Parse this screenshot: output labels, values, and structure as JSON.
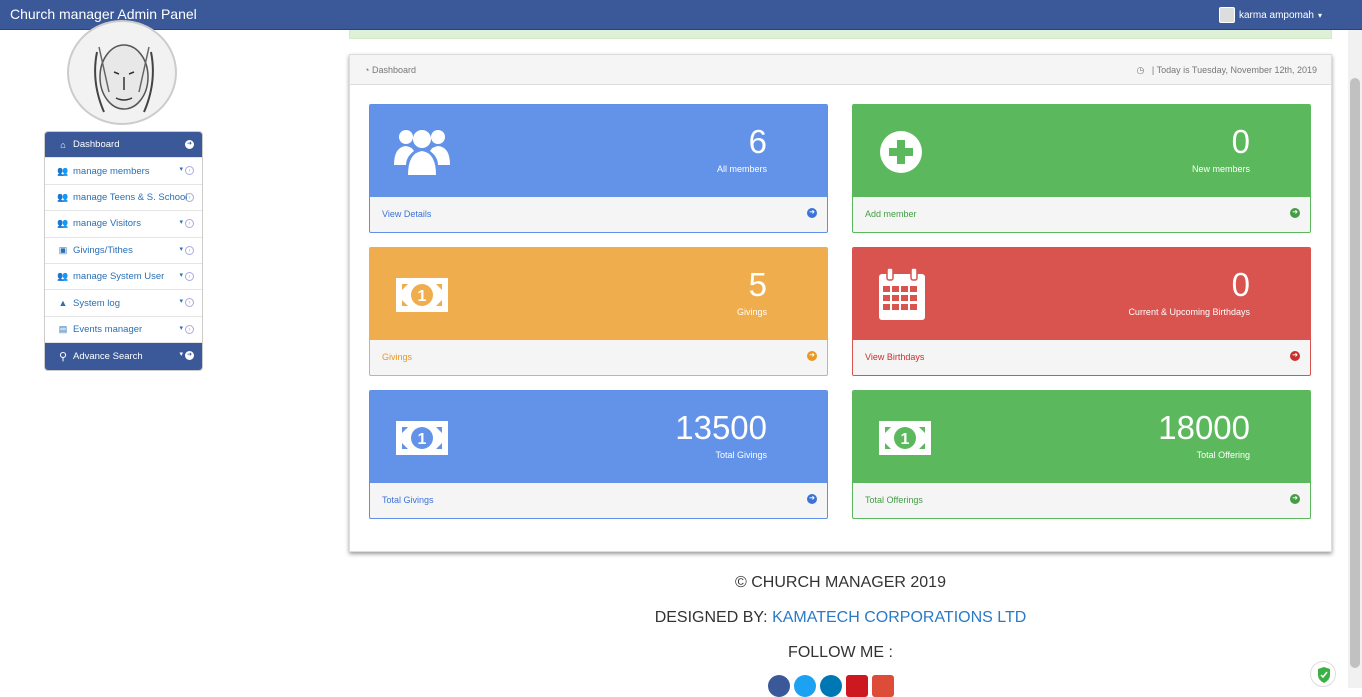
{
  "app": {
    "title": "Church manager Admin Panel",
    "user_name": "karma ampomah"
  },
  "sidebar": {
    "items": [
      {
        "label": "Dashboard",
        "icon": "home-icon"
      },
      {
        "label": "manage members",
        "icon": "users-icon"
      },
      {
        "label": "manage Teens & S. School",
        "icon": "users-icon"
      },
      {
        "label": "manage Visitors",
        "icon": "users-icon"
      },
      {
        "label": "Givings/Tithes",
        "icon": "money-icon"
      },
      {
        "label": "manage System User",
        "icon": "users-icon"
      },
      {
        "label": "System log",
        "icon": "warning-icon"
      },
      {
        "label": "Events manager",
        "icon": "book-icon"
      },
      {
        "label": "Advance Search",
        "icon": "search-icon"
      }
    ]
  },
  "panel": {
    "title": "Dashboard",
    "date_text": "| Today is Tuesday, November 12th, 2019"
  },
  "tiles": [
    {
      "count": "6",
      "label": "All members",
      "link": "View Details",
      "color": "#6393e8",
      "icon": "users-icon"
    },
    {
      "count": "0",
      "label": "New members",
      "link": "Add member",
      "color": "#5cb85c",
      "icon": "plus-circle-icon"
    },
    {
      "count": "5",
      "label": "Givings",
      "link": "Givings",
      "color": "#f0ad4e",
      "icon": "money-icon"
    },
    {
      "count": "0",
      "label": "Current & Upcoming Birthdays",
      "link": "View Birthdays",
      "color": "#d9534f",
      "icon": "calendar-icon"
    },
    {
      "count": "13500",
      "label": "Total Givings",
      "link": "Total Givings",
      "color": "#6393e8",
      "icon": "money-icon"
    },
    {
      "count": "18000",
      "label": "Total Offering",
      "link": "Total Offerings",
      "color": "#5cb85c",
      "icon": "money-icon"
    }
  ],
  "footer": {
    "copyright": "© CHURCH MANAGER 2019",
    "designed_by": "DESIGNED BY:",
    "company": "KAMATECH CORPORATIONS LTD",
    "follow": "FOLLOW ME :"
  }
}
